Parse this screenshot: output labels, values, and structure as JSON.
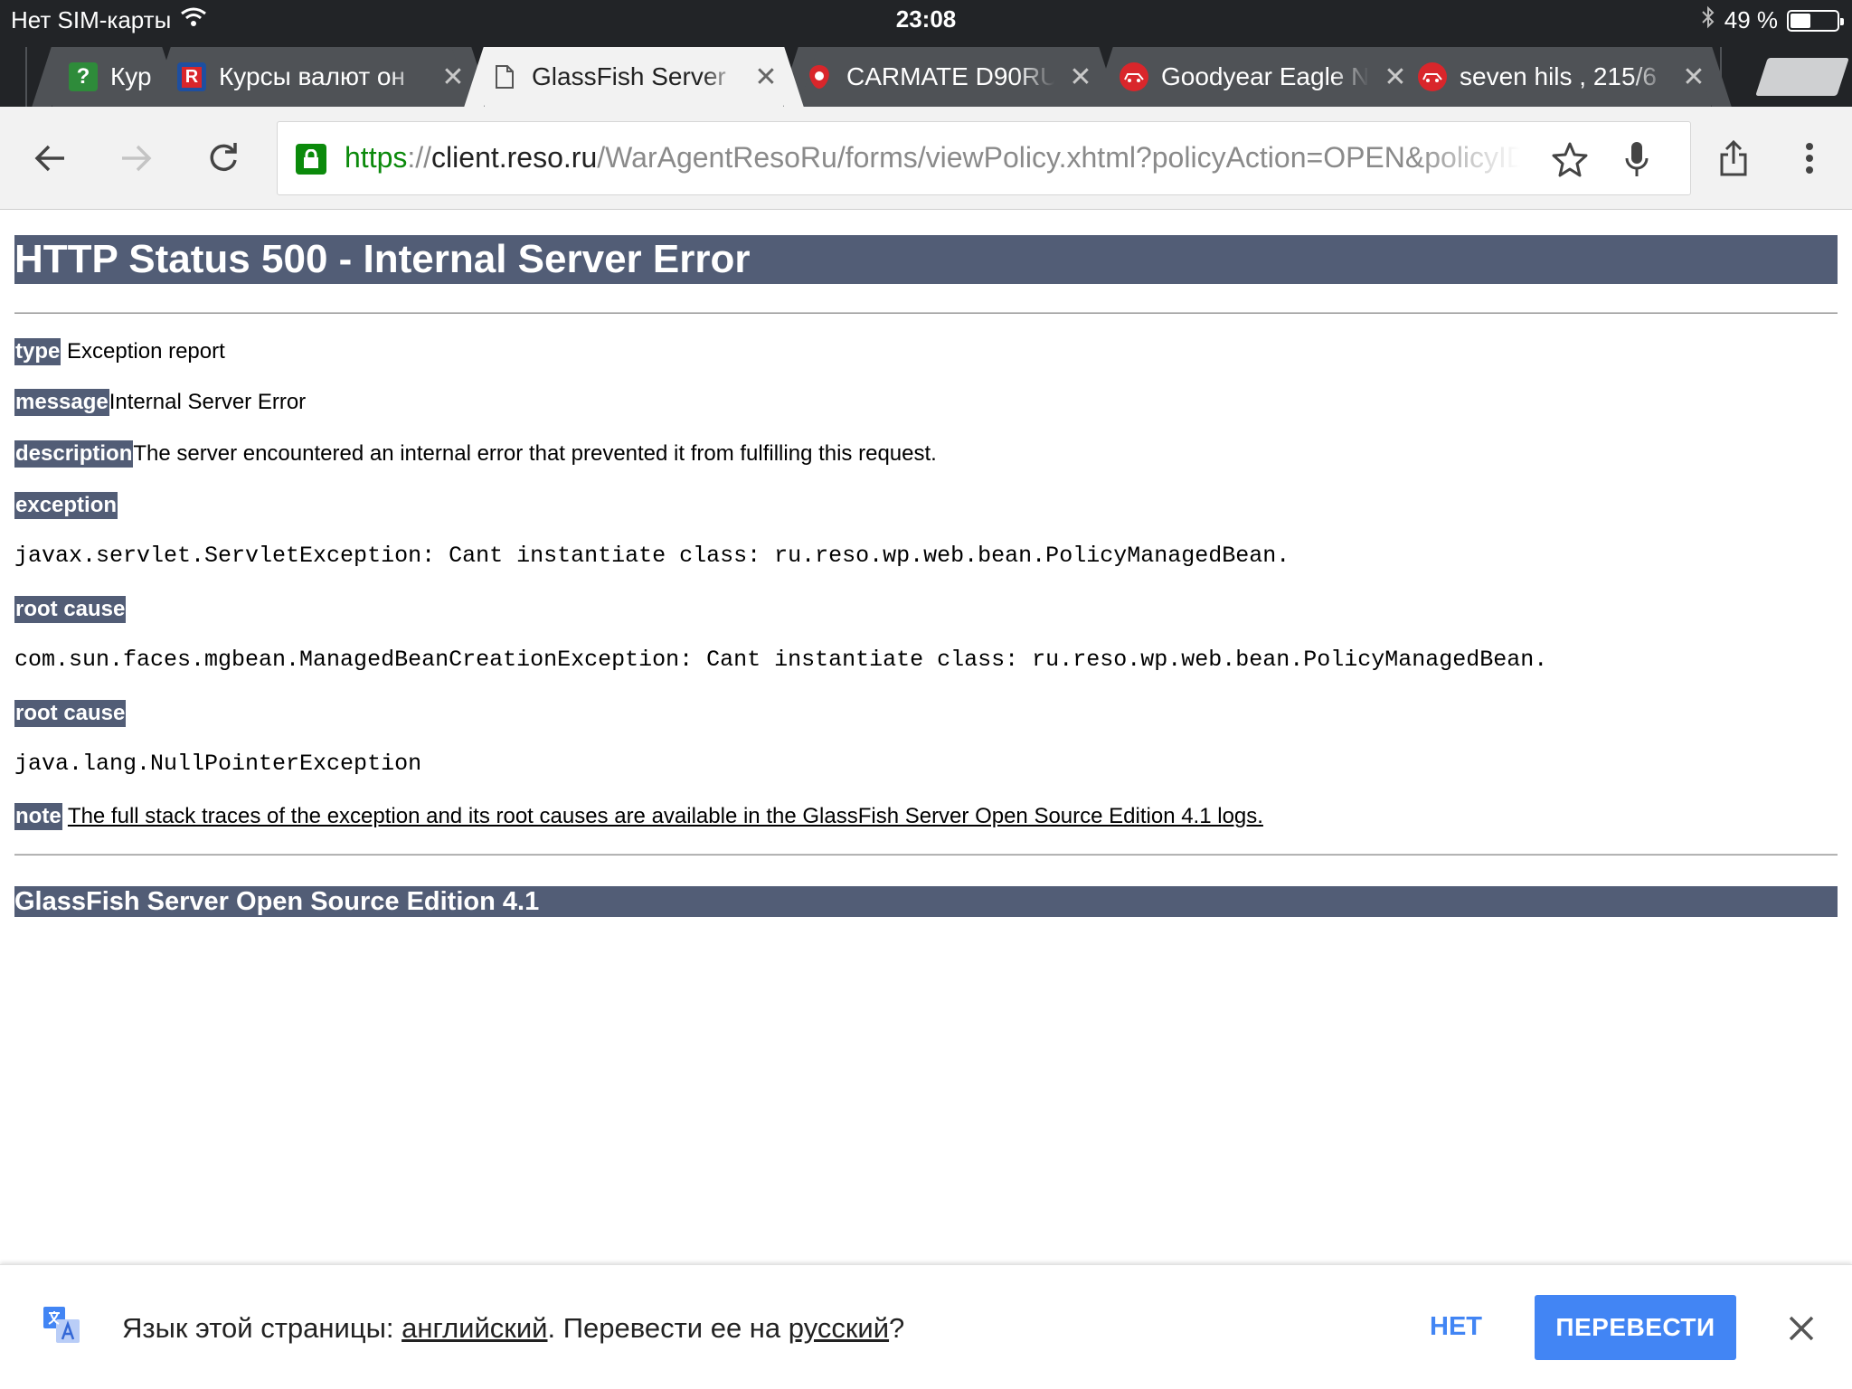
{
  "status": {
    "carrier": "Нет SIM-карты",
    "time": "23:08",
    "battery_text": "49 %",
    "battery_level": 0.49
  },
  "tabs": [
    {
      "title": "Кур",
      "favicon": "question-favicon",
      "active": false
    },
    {
      "title": "Курсы валют он",
      "favicon": "rbc-favicon",
      "active": false
    },
    {
      "title": "GlassFish Server",
      "favicon": "document-favicon",
      "active": true
    },
    {
      "title": "CARMATE D90RU",
      "favicon": "carmate-favicon",
      "active": false
    },
    {
      "title": "Goodyear Eagle N",
      "favicon": "red-car-favicon",
      "active": false
    },
    {
      "title": "seven hils , 215/6",
      "favicon": "red-car-favicon",
      "active": false
    }
  ],
  "omnibox": {
    "scheme": "https",
    "separator": "://",
    "host": "client.reso.ru",
    "path": "/WarAgentResoRu/forms/viewPolicy.xhtml?policyAction=OPEN&policyID="
  },
  "page": {
    "title": "HTTP Status 500 - Internal Server Error",
    "type_label": "type",
    "type_value": " Exception report",
    "message_label": "message",
    "message_value": "Internal Server Error",
    "description_label": "description",
    "description_value": "The server encountered an internal error that prevented it from fulfilling this request.",
    "exception_label": "exception",
    "exception_value": "javax.servlet.ServletException: Cant instantiate class: ru.reso.wp.web.bean.PolicyManagedBean.",
    "root_cause_label_1": "root cause",
    "root_cause_value_1": "com.sun.faces.mgbean.ManagedBeanCreationException: Cant instantiate class: ru.reso.wp.web.bean.PolicyManagedBean.",
    "root_cause_label_2": "root cause",
    "root_cause_value_2": "java.lang.NullPointerException",
    "note_label": "note",
    "note_value": "The full stack traces of the exception and its root causes are available in the GlassFish Server Open Source Edition 4.1 logs.",
    "footer": "GlassFish Server Open Source Edition 4.1"
  },
  "translate": {
    "prefix": "Язык этой страницы: ",
    "source_lang": "английский",
    "middle": ". Перевести ее на ",
    "target_lang": "русский",
    "suffix": "?",
    "no_label": "НЕТ",
    "translate_label": "ПЕРЕВЕСТИ"
  },
  "colors": {
    "chrome_dark": "#222427",
    "tab_inactive": "#4f5256",
    "heading_bg": "#525d76",
    "secure_green": "#0b8a0b",
    "translate_blue": "#4285f4"
  }
}
